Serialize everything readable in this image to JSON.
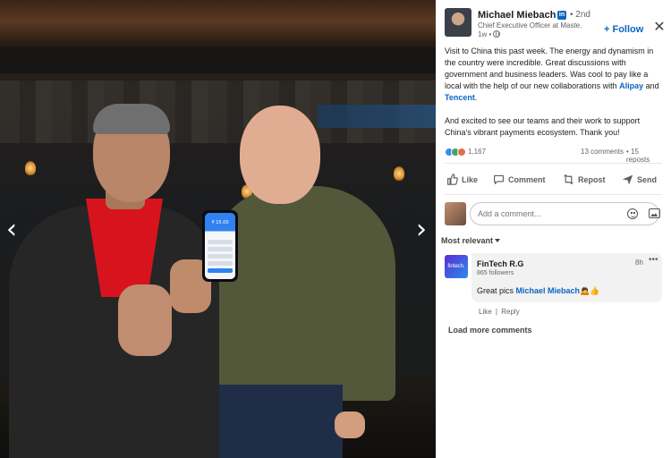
{
  "carousel": {
    "prev_icon": "chevron-left-icon",
    "next_icon": "chevron-right-icon",
    "prev_glyph": "‹",
    "next_glyph": "›"
  },
  "phone_screen": {
    "amount": "¥ 15.00"
  },
  "post": {
    "author": {
      "name": "Michael Miebach",
      "degree": "• 2nd",
      "headline": "Chief Executive Officer at Maste...",
      "time": "1w •"
    },
    "follow_label": "+ Follow",
    "close_glyph": "✕",
    "text": {
      "p1_part1": "Visit to China this past week. The energy and dynamism in the country were incredible. Great discussions with government and business leaders. Was cool to pay like a local with the help of our new collaborations with ",
      "mention_alipay": "Alipay",
      "p1_and": " and ",
      "mention_tencent": "Tencent",
      "p1_end": ".",
      "p2": "And excited to see our teams and their work to support China's vibrant payments ecosystem. Thank you!"
    },
    "social": {
      "reaction_count": "1,167",
      "comments": "13 comments",
      "reposts": "• 15 reposts",
      "reaction_icons": [
        "like-icon",
        "celebrate-icon",
        "love-icon"
      ]
    },
    "actions": {
      "like": "Like",
      "comment": "Comment",
      "repost": "Repost",
      "send": "Send"
    },
    "composer": {
      "placeholder": "Add a comment..."
    },
    "sort_label": "Most relevant",
    "comments": [
      {
        "avatar_text": "fintech.",
        "name": "FinTech R.G",
        "followers": "865 followers",
        "time": "8h",
        "more": "•••",
        "text_prefix": "Great pics ",
        "mention": "Michael Miebach",
        "emojis": "🙇👍",
        "like": "Like",
        "separator": "|",
        "reply": "Reply"
      }
    ],
    "load_more": "Load more comments"
  },
  "colors": {
    "accent": "#0a66c2",
    "shirt_red": "#d7141e",
    "olive_shirt": "#54583b"
  }
}
